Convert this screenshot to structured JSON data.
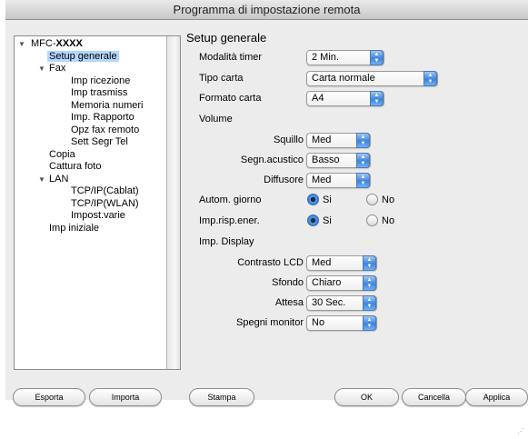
{
  "window": {
    "title": "Programma di impostazione remota"
  },
  "tree": {
    "items": [
      {
        "label": "MFC-XXXX",
        "expanded": true
      },
      {
        "label": "Setup generale"
      },
      {
        "label": "Fax",
        "expanded": true
      },
      {
        "label": "Imp ricezione"
      },
      {
        "label": "Imp trasmiss"
      },
      {
        "label": "Memoria numeri"
      },
      {
        "label": "Imp. Rapporto"
      },
      {
        "label": "Opz fax remoto"
      },
      {
        "label": "Sett Segr Tel"
      },
      {
        "label": "Copia"
      },
      {
        "label": "Cattura foto"
      },
      {
        "label": "LAN",
        "expanded": true
      },
      {
        "label": "TCP/IP(Cablat)"
      },
      {
        "label": "TCP/IP(WLAN)"
      },
      {
        "label": "Impost.varie"
      },
      {
        "label": "Imp iniziale"
      }
    ],
    "selected": "Setup generale"
  },
  "panel": {
    "title": "Setup generale",
    "modalita_timer": {
      "label": "Modalità timer",
      "value": "2 Min."
    },
    "tipo_carta": {
      "label": "Tipo carta",
      "value": "Carta normale"
    },
    "formato_carta": {
      "label": "Formato carta",
      "value": "A4"
    },
    "volume": {
      "label": "Volume"
    },
    "squillo": {
      "label": "Squillo",
      "value": "Med"
    },
    "segn_acustico": {
      "label": "Segn.acustico",
      "value": "Basso"
    },
    "diffusore": {
      "label": "Diffusore",
      "value": "Med"
    },
    "autom_giorno": {
      "label": "Autom. giorno",
      "yes": "Si",
      "no": "No",
      "selected": "Si"
    },
    "imp_risp_ener": {
      "label": "Imp.risp.ener.",
      "yes": "Si",
      "no": "No",
      "selected": "Si"
    },
    "imp_display": {
      "label": "Imp. Display"
    },
    "contrasto_lcd": {
      "label": "Contrasto LCD",
      "value": "Med"
    },
    "sfondo": {
      "label": "Sfondo",
      "value": "Chiaro"
    },
    "attesa": {
      "label": "Attesa",
      "value": "30 Sec."
    },
    "spegni_monitor": {
      "label": "Spegni monitor",
      "value": "No"
    }
  },
  "buttons": {
    "esporta": "Esporta",
    "importa": "Importa",
    "stampa": "Stampa",
    "ok": "OK",
    "cancella": "Cancella",
    "applica": "Applica"
  },
  "colors": {
    "accent": "#3d84de",
    "selection": "#b5d5ff"
  },
  "icons": {
    "expand": "disclosure-triangle-icon",
    "select": "popup-arrows-icon",
    "resize": "resize-grip-icon"
  }
}
